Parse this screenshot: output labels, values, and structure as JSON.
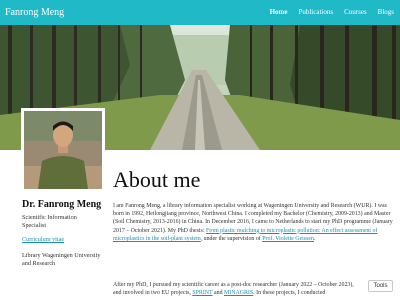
{
  "site": {
    "title": "Fanrong Meng"
  },
  "nav": {
    "items": [
      {
        "label": "Home",
        "active": true
      },
      {
        "label": "Publications",
        "active": false
      },
      {
        "label": "Courses",
        "active": false
      },
      {
        "label": "Blogs",
        "active": false
      }
    ]
  },
  "colors": {
    "header_bg": "#20b9c8",
    "link": "#1a8fb0"
  },
  "sidebar": {
    "name": "Dr. Fanrong Meng",
    "role": "Scientific Information Specialist",
    "cv_link": "Curriculum vitae",
    "affiliation": "Library Wageningen University and Research"
  },
  "main": {
    "title": "About me",
    "intro_1": "I am Fanrong Meng, a library information specialist working at Wageningen University and Research (WUR). I was born in 1992, Heilongjiang province, Northwest China. I completed my Bachelor (Chemistry, 2009-2013) and Master (Soil Chemistry, 2013-2016) in China. In December 2016, I came to Netherlands to start my PhD programme (January 2017 – October 2021). My PhD thesis: ",
    "thesis_link": "From plastic mulching to microplastic pollution: An effect assessment of microplastics in the soil-plant system",
    "intro_2": ", under the supervision of ",
    "supervisor_link": "Prof. Violette Geissen",
    "intro_3": ".",
    "para2_1": "After my PhD, I pursued my scientific career as a post-doc researcher (January 2022 – October 2023), and involved in two EU projects, ",
    "project1_link": "SPRINT",
    "para2_2": " and ",
    "project2_link": "MINAGRIS",
    "para2_3": ". In these projects, I conducted"
  },
  "tools_button": "Tools"
}
